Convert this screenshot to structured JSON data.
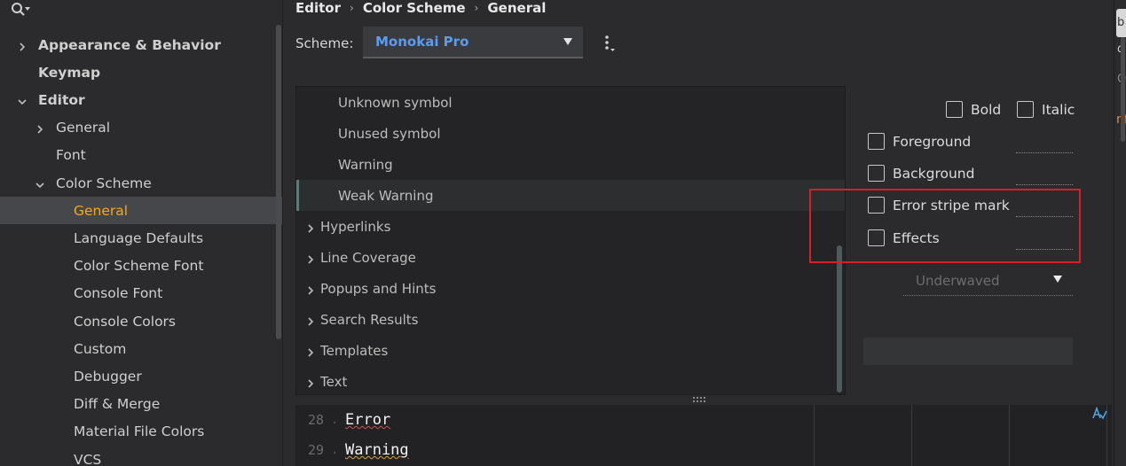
{
  "sidebar": {
    "items": [
      {
        "label": "Appearance & Behavior",
        "bold": true,
        "chevron": "right"
      },
      {
        "label": "Keymap",
        "bold": true,
        "chevron": ""
      },
      {
        "label": "Editor",
        "bold": true,
        "chevron": "down"
      },
      {
        "label": "General",
        "bold": false,
        "chevron": "right"
      },
      {
        "label": "Font",
        "bold": false,
        "chevron": ""
      },
      {
        "label": "Color Scheme",
        "bold": false,
        "chevron": "down"
      },
      {
        "label": "General",
        "bold": false,
        "chevron": "",
        "selected": true
      },
      {
        "label": "Language Defaults",
        "bold": false,
        "chevron": ""
      },
      {
        "label": "Color Scheme Font",
        "bold": false,
        "chevron": ""
      },
      {
        "label": "Console Font",
        "bold": false,
        "chevron": ""
      },
      {
        "label": "Console Colors",
        "bold": false,
        "chevron": ""
      },
      {
        "label": "Custom",
        "bold": false,
        "chevron": ""
      },
      {
        "label": "Debugger",
        "bold": false,
        "chevron": ""
      },
      {
        "label": "Diff & Merge",
        "bold": false,
        "chevron": ""
      },
      {
        "label": "Material File Colors",
        "bold": false,
        "chevron": ""
      },
      {
        "label": "VCS",
        "bold": false,
        "chevron": ""
      }
    ]
  },
  "breadcrumb": [
    "Editor",
    "Color Scheme",
    "General"
  ],
  "scheme": {
    "label": "Scheme:",
    "value": "Monokai Pro"
  },
  "tree": {
    "rows": [
      {
        "label": "Unknown symbol",
        "kind": "sub"
      },
      {
        "label": "Unused symbol",
        "kind": "sub"
      },
      {
        "label": "Warning",
        "kind": "sub"
      },
      {
        "label": "Weak Warning",
        "kind": "sub",
        "selected": true
      },
      {
        "label": "Hyperlinks",
        "kind": "group"
      },
      {
        "label": "Line Coverage",
        "kind": "group"
      },
      {
        "label": "Popups and Hints",
        "kind": "group"
      },
      {
        "label": "Search Results",
        "kind": "group"
      },
      {
        "label": "Templates",
        "kind": "group"
      },
      {
        "label": "Text",
        "kind": "group"
      }
    ]
  },
  "options": {
    "bold": "Bold",
    "italic": "Italic",
    "foreground": "Foreground",
    "background": "Background",
    "error_stripe": "Error stripe mark",
    "effects": "Effects",
    "effect_type": "Underwaved"
  },
  "preview": {
    "lines": [
      {
        "num": "28",
        "text": "Error",
        "underline": "#c75450"
      },
      {
        "num": "29",
        "text": "Warning",
        "underline": "#d9a343"
      }
    ]
  },
  "edge": {
    "top_text": "b",
    "d": "d",
    "o": "O",
    "nf": "nf"
  },
  "colors": {
    "accent_selected": "#f5a623",
    "scheme_value": "#5b9bf0",
    "highlight_box": "#d61f26"
  }
}
